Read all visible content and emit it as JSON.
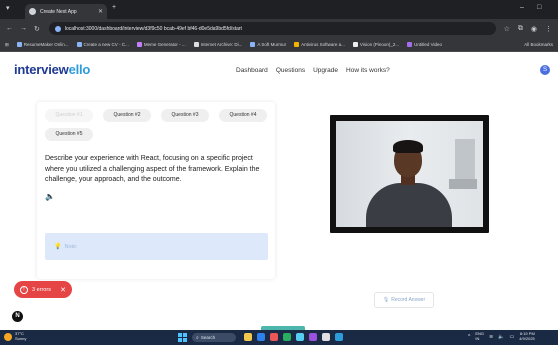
{
  "browser": {
    "tab_title": "Create Next App",
    "url": "localhost:3000/dashboard/interview/d3f9c50 bcab-49ef bf46-d0e5da9bd5fd/start",
    "bookmarks": [
      "ResumeMaker Onlin...",
      "Create a new CV - C...",
      "Meme Generator - ...",
      "Internet Archive: Di...",
      "A Soft Murmur",
      "Antivirus Software a...",
      "Vision (Pinoon)_2...",
      "Untitled Video"
    ],
    "all_bookmarks": "All Bookmarks"
  },
  "app": {
    "logo_part1": "interview",
    "logo_part2": "ello",
    "nav": [
      "Dashboard",
      "Questions",
      "Upgrade",
      "How its works?"
    ],
    "avatar_initial": "S"
  },
  "questions": {
    "tabs": [
      "Question #1",
      "Question #2",
      "Question #3",
      "Question #4",
      "Question #5"
    ],
    "active_index": 0,
    "text": "Describe your experience with React, focusing on a specific project where you utilized a challenging aspect of the framework. Explain the challenge, your approach, and the outcome.",
    "note_label": "Note:"
  },
  "record": {
    "label": "Record Answer"
  },
  "errors": {
    "label": "3 errors"
  },
  "taskbar": {
    "weather_temp": "37°C",
    "weather_desc": "Sunny",
    "search_label": "Search",
    "lang_1": "ENG",
    "lang_2": "IN",
    "time": "8:19 PM",
    "date": "4/9/2025"
  },
  "colors": {
    "logo_dark": "#1f3a93",
    "logo_light": "#2d9bdb",
    "note_bg": "#dde9fb",
    "error_red": "#e64545",
    "taskbar": "#1b2a44"
  }
}
